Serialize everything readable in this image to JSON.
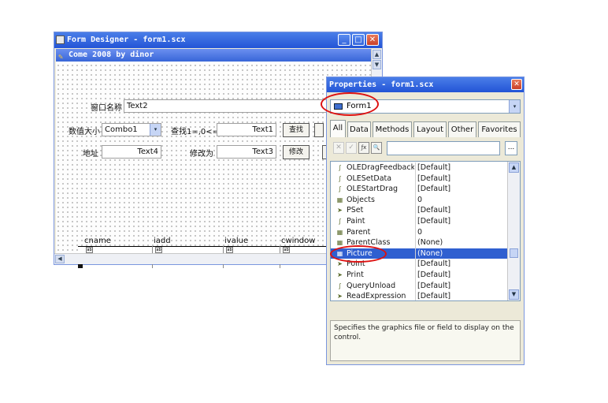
{
  "form_designer": {
    "title": "Form Designer - form1.scx",
    "minimize": "_",
    "maximize": "□",
    "close": "✕",
    "form_caption": "Come 2008 by dinor",
    "scroll_up": "▲",
    "scroll_down": "▼",
    "scroll_left": "◀",
    "controls": {
      "label_window_name": "窗口名称",
      "text_window_name": "Text2",
      "label_data_size": "数值大小",
      "combo_value": "Combo1",
      "combo_arrow": "▾",
      "label_find": "查找1=,0<=",
      "text_find": "Text1",
      "button_find": "查找",
      "label_address": "地址",
      "text_address": "Text4",
      "label_modify": "修改为",
      "text_modify": "Text3",
      "button_modify": "修改"
    },
    "grid": {
      "columns": [
        "cname",
        "iadd",
        "ivalue",
        "cwindow"
      ],
      "cell_glyph": "ab"
    }
  },
  "properties": {
    "title": "Properties - form1.scx",
    "close": "✕",
    "object": "Form1",
    "object_arrow": "▾",
    "tabs": [
      "All",
      "Data",
      "Methods",
      "Layout",
      "Other",
      "Favorites"
    ],
    "active_tab": "All",
    "tool_icons": [
      "cancel-icon",
      "accept-icon",
      "function-icon",
      "zoom-icon"
    ],
    "tool_glyphs": [
      "✕",
      "✓",
      "ƒx",
      "🔍"
    ],
    "more_button": "...",
    "rows": [
      {
        "name": "OLEDragFeedback",
        "value": "[Default]",
        "icon": "method-icon",
        "glyph": "∫"
      },
      {
        "name": "OLESetData",
        "value": "[Default]",
        "icon": "method-icon",
        "glyph": "∫"
      },
      {
        "name": "OLEStartDrag",
        "value": "[Default]",
        "icon": "method-icon",
        "glyph": "∫"
      },
      {
        "name": "Objects",
        "value": "0",
        "icon": "object-icon",
        "glyph": "▦"
      },
      {
        "name": "PSet",
        "value": "[Default]",
        "icon": "event-icon",
        "glyph": "➤"
      },
      {
        "name": "Paint",
        "value": "[Default]",
        "icon": "method-icon",
        "glyph": "∫"
      },
      {
        "name": "Parent",
        "value": "0",
        "icon": "object-icon",
        "glyph": "▦"
      },
      {
        "name": "ParentClass",
        "value": "(None)",
        "icon": "object-icon",
        "glyph": "▦"
      },
      {
        "name": "Picture",
        "value": "(None)",
        "icon": "property-icon",
        "glyph": "▦",
        "selected": true
      },
      {
        "name": "Point",
        "value": "[Default]",
        "icon": "event-icon",
        "glyph": "➤"
      },
      {
        "name": "Print",
        "value": "[Default]",
        "icon": "event-icon",
        "glyph": "➤"
      },
      {
        "name": "QueryUnload",
        "value": "[Default]",
        "icon": "method-icon",
        "glyph": "∫"
      },
      {
        "name": "ReadExpression",
        "value": "[Default]",
        "icon": "event-icon",
        "glyph": "➤"
      }
    ],
    "scroll_up": "▲",
    "scroll_down": "▼",
    "description": "Specifies the graphics file or field to display on the control."
  },
  "colors": {
    "title_bar": "#2354d6",
    "selection": "#2f5fd0",
    "annotation_ring": "#dd1111"
  }
}
